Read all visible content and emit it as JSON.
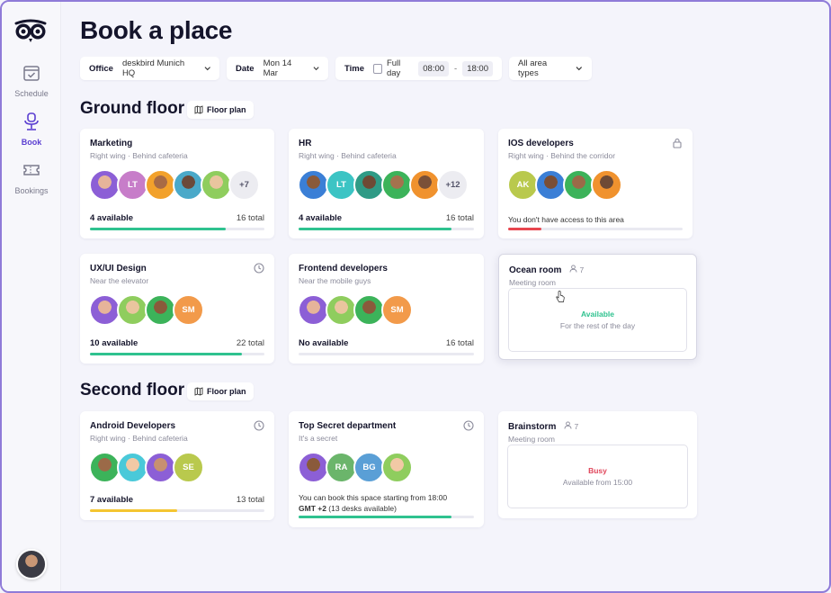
{
  "nav": {
    "items": [
      {
        "label": "Schedule",
        "icon": "calendar-check-icon"
      },
      {
        "label": "Book",
        "icon": "office-chair-icon"
      },
      {
        "label": "Bookings",
        "icon": "ticket-icon"
      }
    ]
  },
  "page": {
    "title": "Book a place"
  },
  "filters": {
    "office_key": "Office",
    "office_value": "deskbird Munich HQ",
    "date_key": "Date",
    "date_value": "Mon 14 Mar",
    "time_key": "Time",
    "full_day": "Full day",
    "time_from": "08:00",
    "time_sep": "-",
    "time_to": "18:00",
    "area": "All area types"
  },
  "sections": [
    {
      "title": "Ground floor",
      "plan_label": "Floor plan"
    },
    {
      "title": "Second floor",
      "plan_label": "Floor plan"
    }
  ],
  "cards": {
    "marketing": {
      "name": "Marketing",
      "sub": "Right wing · Behind cafeteria",
      "avail": "4 available",
      "total": "16 total",
      "fill": 0.78,
      "more": "+7",
      "initials": "LT"
    },
    "hr": {
      "name": "HR",
      "sub": "Right wing · Behind cafeteria",
      "avail": "4 available",
      "total": "16 total",
      "fill": 0.87,
      "more": "+12",
      "initials": "LT"
    },
    "ios": {
      "name": "IOS developers",
      "sub": "Right wing · Behind the corridor",
      "initials": "AK",
      "note": "You don't have access to this area",
      "fill": 0.19
    },
    "uxui": {
      "name": "UX/UI Design",
      "sub": "Near the elevator",
      "initials": "SM",
      "avail": "10 available",
      "total": "22 total",
      "fill": 0.87
    },
    "frontend": {
      "name": "Frontend developers",
      "sub": "Near the mobile guys",
      "initials": "SM",
      "avail": "No available",
      "total": "16 total"
    },
    "ocean": {
      "name": "Ocean room",
      "cap": "7",
      "sub": "Meeting room",
      "status": "Available",
      "desc": "For the rest of the day"
    },
    "android": {
      "name": "Android Developers",
      "sub": "Right wing · Behind cafeteria",
      "initials": "SE",
      "avail": "7 available",
      "total": "13 total",
      "fill": 0.5
    },
    "secret": {
      "name": "Top Secret department",
      "sub": "It's a secret",
      "initials1": "RA",
      "initials2": "BG",
      "note1": "You can book this space starting from 18:00",
      "note2a": "GMT +2",
      "note2b": " (13 desks available)",
      "fill": 0.87
    },
    "brainstorm": {
      "name": "Brainstorm",
      "cap": "7",
      "sub": "Meeting room",
      "status": "Busy",
      "desc": "Available from 15:00"
    }
  },
  "colors": {
    "accent": "#5b3fd1",
    "green": "#2fc28f",
    "red": "#e8464f",
    "yellow": "#f4c531",
    "available": "#2fc28f",
    "busy": "#e0455a"
  }
}
